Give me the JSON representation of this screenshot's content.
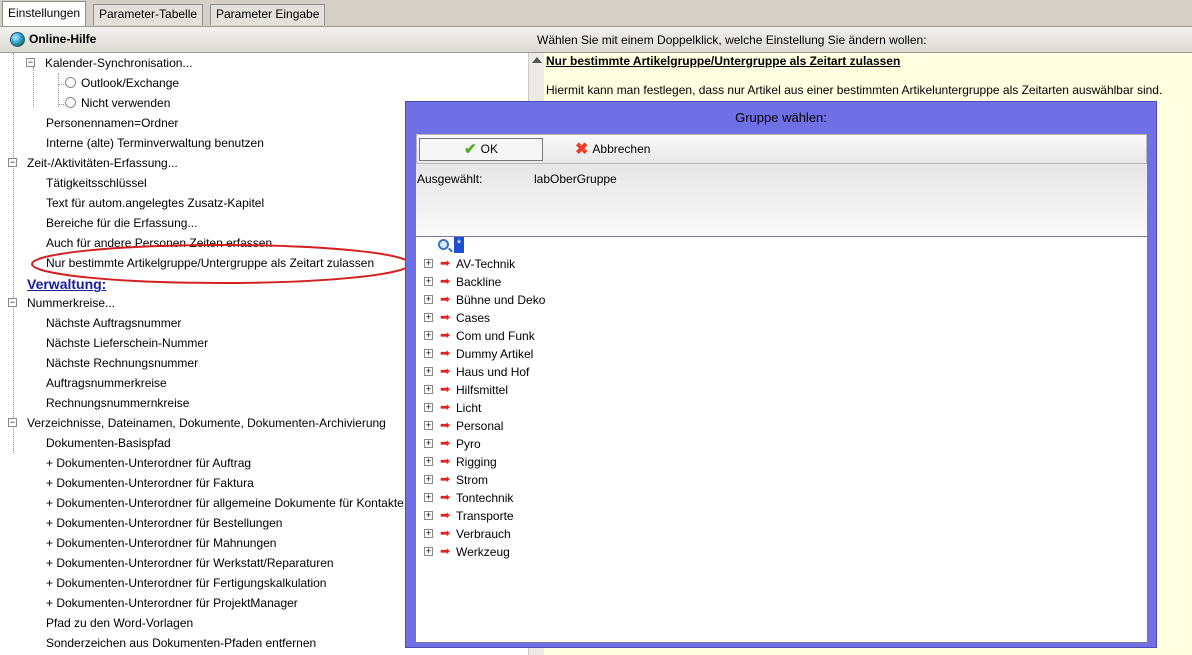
{
  "tabs": [
    {
      "label": "Einstellungen",
      "active": true
    },
    {
      "label": "Parameter-Tabelle",
      "active": false
    },
    {
      "label": "Parameter Eingabe",
      "active": false
    }
  ],
  "header": {
    "online_help": "Online-Hilfe",
    "instruction": "Wählen Sie mit einem Doppelklick, welche Einstellung Sie ändern wollen:"
  },
  "tree": {
    "items": [
      {
        "label": "Kalender-Synchronisation..."
      },
      {
        "label": "Outlook/Exchange"
      },
      {
        "label": "Nicht verwenden"
      },
      {
        "label": "Personennamen=Ordner"
      },
      {
        "label": "Interne (alte) Terminverwaltung benutzen"
      },
      {
        "label": "Zeit-/Aktivitäten-Erfassung..."
      },
      {
        "label": "Tätigkeitsschlüssel"
      },
      {
        "label": "Text für autom.angelegtes Zusatz-Kapitel"
      },
      {
        "label": "Bereiche für die Erfassung..."
      },
      {
        "label": "Auch für andere Personen Zeiten erfassen"
      },
      {
        "label": "Nur bestimmte Artikelgruppe/Untergruppe als Zeitart zulassen"
      },
      {
        "label": "Verwaltung:"
      },
      {
        "label": "Nummerkreise..."
      },
      {
        "label": "Nächste Auftragsnummer"
      },
      {
        "label": "Nächste Lieferschein-Nummer"
      },
      {
        "label": "Nächste Rechnungsnummer"
      },
      {
        "label": "Auftragsnummerkreise"
      },
      {
        "label": "Rechnungsnummernkreise"
      },
      {
        "label": "Verzeichnisse, Dateinamen, Dokumente, Dokumenten-Archivierung"
      },
      {
        "label": "Dokumenten-Basispfad"
      },
      {
        "label": "+ Dokumenten-Unterordner für Auftrag"
      },
      {
        "label": "+ Dokumenten-Unterordner für Faktura"
      },
      {
        "label": "+ Dokumenten-Unterordner für allgemeine Dokumente für Kontakte"
      },
      {
        "label": "+ Dokumenten-Unterordner für Bestellungen"
      },
      {
        "label": "+ Dokumenten-Unterordner für Mahnungen"
      },
      {
        "label": "+ Dokumenten-Unterordner für Werkstatt/Reparaturen"
      },
      {
        "label": "+ Dokumenten-Unterordner für Fertigungskalkulation"
      },
      {
        "label": "+ Dokumenten-Unterordner für ProjektManager"
      },
      {
        "label": "Pfad zu den Word-Vorlagen"
      },
      {
        "label": "Sonderzeichen aus Dokumenten-Pfaden entfernen"
      }
    ]
  },
  "help": {
    "title": "Nur bestimmte Artikelgruppe/Untergruppe als Zeitart zulassen",
    "text": "Hiermit kann man festlegen, dass nur Artikel aus einer bestimmten Artikeluntergruppe als Zeitarten auswählbar sind."
  },
  "dialog": {
    "title": "Gruppe wählen:",
    "ok_label": "OK",
    "cancel_label": "Abbrechen",
    "selected_label": "Ausgewählt:",
    "selected_value": "labOberGruppe",
    "root_label": "*",
    "groups": [
      "AV-Technik",
      "Backline",
      "Bühne und Deko",
      "Cases",
      "Com und Funk",
      "Dummy Artikel",
      "Haus und Hof",
      "Hilfsmittel",
      "Licht",
      "Personal",
      "Pyro",
      "Rigging",
      "Strom",
      "Tontechnik",
      "Transporte",
      "Verbrauch",
      "Werkzeug"
    ]
  },
  "colors": {
    "dialog_background": "#6f6fe6",
    "help_background": "#ffffe1",
    "annotation": "#d42020",
    "link": "#1a1a9c"
  }
}
